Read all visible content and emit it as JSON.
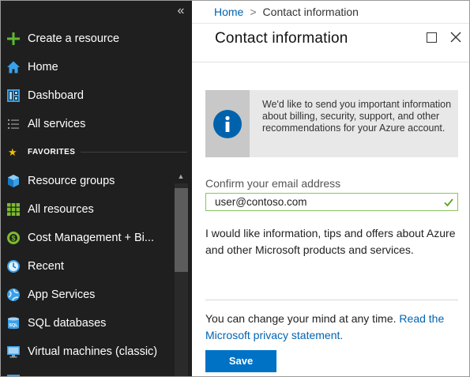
{
  "sidebar": {
    "collapse_glyph": "«",
    "items": [
      {
        "label": "Create a resource",
        "icon": "plus-icon"
      },
      {
        "label": "Home",
        "icon": "home-icon"
      },
      {
        "label": "Dashboard",
        "icon": "dashboard-icon"
      },
      {
        "label": "All services",
        "icon": "list-icon"
      }
    ],
    "favorites_label": "FAVORITES",
    "favorites": [
      {
        "label": "Resource groups",
        "icon": "resource-groups-icon"
      },
      {
        "label": "All resources",
        "icon": "grid-icon"
      },
      {
        "label": "Cost Management + Bi...",
        "icon": "cost-management-icon"
      },
      {
        "label": "Recent",
        "icon": "clock-icon"
      },
      {
        "label": "App Services",
        "icon": "globe-icon"
      },
      {
        "label": "SQL databases",
        "icon": "sql-database-icon"
      },
      {
        "label": "Virtual machines (classic)",
        "icon": "monitor-icon"
      }
    ]
  },
  "breadcrumb": {
    "home": "Home",
    "separator": ">",
    "current": "Contact information"
  },
  "panel": {
    "title": "Contact information",
    "info_text": "We'd like to send you important information about billing, security, support, and other recommendations for your Azure account.",
    "email_label": "Confirm your email address",
    "email_value": "user@contoso.com",
    "opt_text": "I would like information, tips and offers about Azure and other Microsoft products and services.",
    "change_text": "You can change your mind at any time. ",
    "privacy_link": "Read the Microsoft privacy statement.",
    "save_label": "Save"
  },
  "colors": {
    "sidebar_bg": "#1f1f1f",
    "accent": "#0072c6",
    "link": "#0063b1",
    "valid_green": "#5ba31a",
    "favorite_star": "#f0c000"
  }
}
